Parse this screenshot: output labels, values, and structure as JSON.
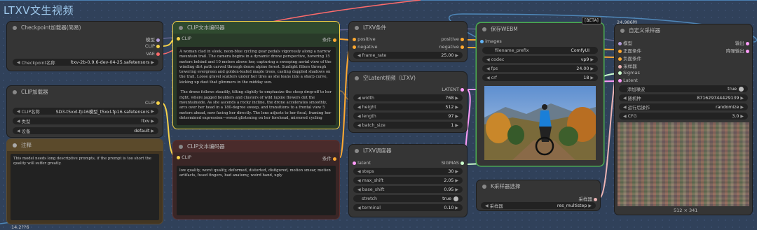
{
  "group": {
    "title": "LTXV文生视频"
  },
  "canvas": {
    "counter_top": "24,986秒",
    "counter_bottom": "14.2??6"
  },
  "checkpoint": {
    "title": "Checkpoint加载器(简易)",
    "out_model": "模型",
    "out_clip": "CLIP",
    "out_vae": "VAE",
    "w_label": "Checkpoint名称",
    "w_value": "ltxv-2b-0.9.6-dev-04-25.safetensors"
  },
  "clip_loader": {
    "title": "CLIP加载器",
    "out_clip": "CLIP",
    "w1_label": "CLIP名称",
    "w1_value": "SD3-t5xxl-fp16模型_t5xxl-fp16.safetensors",
    "w2_label": "类型",
    "w2_value": "ltxv",
    "w3_label": "设备",
    "w3_value": "default"
  },
  "note": {
    "title": "注释",
    "text": "This model needs long descriptive prompts, if the prompt is too short the quality will suffer greatly."
  },
  "clip_pos": {
    "title": "CLIP文本编码器",
    "in_clip": "CLIP",
    "out": "条件",
    "text": "A woman clad in sleek, neon-blue cycling gear pedals vigorously along a narrow mountain trail. The camera begins in a dynamic drone perspective, hovering 15 meters behind and 10 meters above her, capturing a sweeping aerial view of the winding dirt path carved through dense alpine forest. Sunlight filters through towering evergreen and golden-leafed maple trees, casting dappled shadows on the trail. Loose gravel scatters under her tires as she leans into a sharp curve, kicking up dust that glimmers in the midday sun.\n\n The drone follows steadily, tilting slightly to emphasize the steep drop-off to her right, where jagged boulders and clusters of wild lupine flowers dot the mountainside. As she ascends a rocky incline, the drone accelerates smoothly, arcs over her head in a 180-degree sweep, and transitions to a frontal view 5 meters ahead, now facing her directly. The lens adjusts to her focal, framing her determined expression—sweat glistening on her forehead, mirrored cycling"
  },
  "clip_neg": {
    "title": "CLIP文本编码器",
    "in_clip": "CLIP",
    "out": "条件",
    "text": "low quality, worst quality, deformed, distorted, disfigured, motion smear, motion artifacts, fused fingers, bad anatomy, weird hand, ugly"
  },
  "ltxv_cond": {
    "title": "LTXV条件",
    "in1": "positive",
    "in2": "negative",
    "out1": "positive",
    "out2": "negative",
    "w_label": "frame_rate",
    "w_value": "25.00"
  },
  "latent": {
    "title": "空Latent视频（LTXV)",
    "out": "LATENT",
    "w": [
      {
        "l": "width",
        "v": "768"
      },
      {
        "l": "height",
        "v": "512"
      },
      {
        "l": "length",
        "v": "97"
      },
      {
        "l": "batch_size",
        "v": "1"
      }
    ]
  },
  "scheduler": {
    "title": "LTXV调度器",
    "in": "latent",
    "out": "SIGMAS",
    "w": [
      {
        "l": "steps",
        "v": "30"
      },
      {
        "l": "max_shift",
        "v": "2.05"
      },
      {
        "l": "base_shift",
        "v": "0.95"
      },
      {
        "l": "stretch",
        "v": "true"
      },
      {
        "l": "terminal",
        "v": "0.10"
      }
    ]
  },
  "save": {
    "title": "保存WEBM",
    "badge": "[BETA]",
    "in": "images",
    "w": [
      {
        "l": "filename_prefix",
        "v": "ComfyUI"
      },
      {
        "l": "codec",
        "v": "vp9"
      },
      {
        "l": "fps",
        "v": "24.00"
      },
      {
        "l": "crf",
        "v": "18"
      }
    ]
  },
  "sampler_select": {
    "title": "K采样器选择",
    "out": "采样器",
    "w_label": "采样器",
    "w_value": "res_multistep"
  },
  "custom_sampler": {
    "title": "自定义采样器",
    "in": [
      "模型",
      "正面条件",
      "负面条件",
      "采样器",
      "Sigmas",
      "Latent"
    ],
    "out": [
      "输出",
      "降噪输出"
    ],
    "w": [
      {
        "l": "添加噪波",
        "v": "true"
      },
      {
        "l": "随机种",
        "v": "871629744429139"
      },
      {
        "l": "运行后操作",
        "v": "randomize"
      },
      {
        "l": "CFG",
        "v": "3.0"
      }
    ],
    "size": "512 × 341"
  },
  "colors": {
    "clip": "#f6d24a",
    "model": "#b39ddb",
    "vae": "#ff6b6b",
    "cond": "#ffa931",
    "latent": "#ff9cf9",
    "image": "#64b5f6",
    "sigmas": "#cdffcd",
    "sampler": "#ecb4b4"
  }
}
